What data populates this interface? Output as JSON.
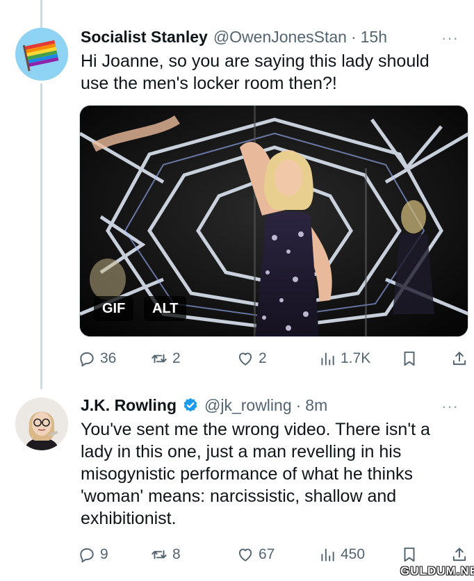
{
  "tweets": [
    {
      "name": "Socialist Stanley",
      "verified": false,
      "handle": "@OwenJonesStan",
      "separator": "·",
      "time": "15h",
      "more": "···",
      "text": "Hi Joanne, so you are saying this lady should use the men's locker room then?!",
      "media": {
        "gif_badge": "GIF",
        "alt_badge": "ALT"
      },
      "actions": {
        "replies": "36",
        "retweets": "2",
        "likes": "2",
        "views": "1.7K"
      }
    },
    {
      "name": "J.K. Rowling",
      "verified": true,
      "handle": "@jk_rowling",
      "separator": "·",
      "time": "8m",
      "more": "···",
      "text": "You've sent me the wrong video. There isn't a lady in this one, just a man revelling in his misogynistic performance of what he thinks 'woman' means: narcissistic, shallow and exhibitionist.",
      "actions": {
        "replies": "9",
        "retweets": "8",
        "likes": "67",
        "views": "450"
      }
    }
  ],
  "watermark": "GULDUM.NET",
  "colors": {
    "text": "#0f1419",
    "muted": "#536471",
    "verified": "#1d9bf0",
    "thread_line": "#cfd9de"
  }
}
